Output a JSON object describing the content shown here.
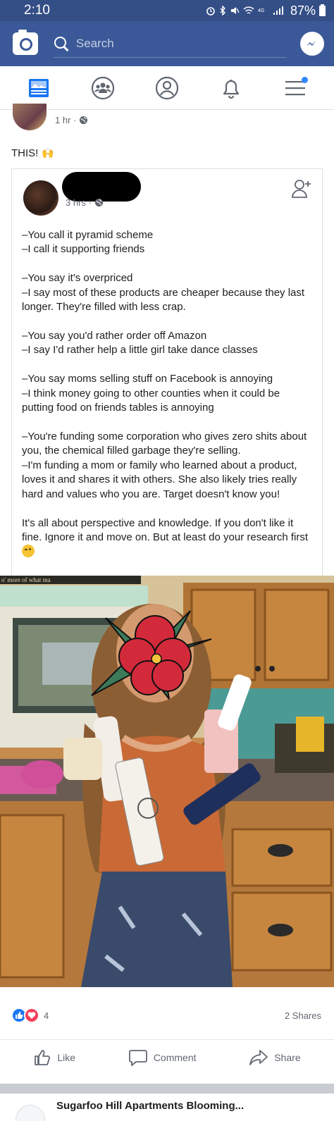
{
  "status_bar": {
    "time": "2:10",
    "battery": "87%"
  },
  "top_bar": {
    "search_placeholder": "Search"
  },
  "nav": [
    "news-feed",
    "groups",
    "profile",
    "notifications",
    "menu"
  ],
  "post": {
    "time": "1 hr ·",
    "caption": "THIS!",
    "shared": {
      "time": "3 hrs ·",
      "paragraphs": [
        "–You call it pyramid scheme\n–I call it supporting friends",
        "–You say it's overpriced\n–I say most of these products are cheaper because they last longer. They're filled with less crap.",
        "–You say you'd rather order off Amazon\n–I say I'd rather help a little girl take dance classes",
        "–You say moms selling stuff on Facebook is annoying\n–I think money going to other counties when it could be putting food on friends tables is annoying",
        "–You're funding some corporation who gives zero shits about you, the chemical filled garbage they're selling.\n–I'm funding a mom or family who learned about a product, loves it and shares it with others. She also likely tries really hard and values who you are. Target doesn't know you!",
        "It's all about perspective and knowledge. If you don't like it fine. Ignore it and move on. But at least do your research first"
      ]
    },
    "photo_sign_text": "o' more of what ma",
    "reaction_count": "4",
    "shares": "2 Shares",
    "actions": {
      "like": "Like",
      "comment": "Comment",
      "share": "Share"
    }
  },
  "next_post": {
    "title": "Sugarfoo Hill Apartments Blooming..."
  },
  "colors": {
    "facebook_blue": "#3b5998",
    "status_bar": "#344e86",
    "like_blue": "#1877f2",
    "love_red": "#f33e58"
  }
}
